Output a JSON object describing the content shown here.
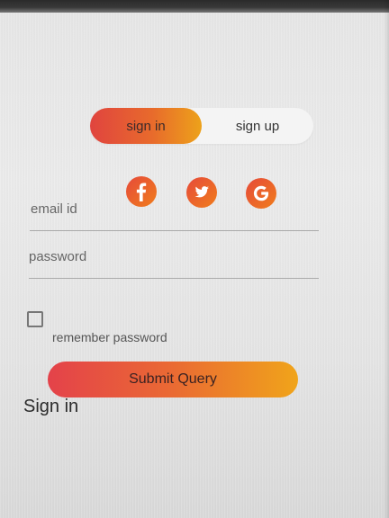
{
  "auth_toggle": {
    "sign_in_label": "sign in",
    "sign_up_label": "sign up",
    "active": "sign in"
  },
  "social": {
    "icons": [
      "facebook-icon",
      "twitter-icon",
      "google-icon"
    ]
  },
  "form": {
    "email_label": "email id",
    "password_label": "password",
    "remember_label": "remember password",
    "remember_checked": false,
    "submit_label": "Submit Query"
  },
  "footer": {
    "title": "Sign in"
  },
  "colors": {
    "gradient_start": "#e4424a",
    "gradient_mid": "#ea6a33",
    "gradient_end": "#f0a41a"
  }
}
